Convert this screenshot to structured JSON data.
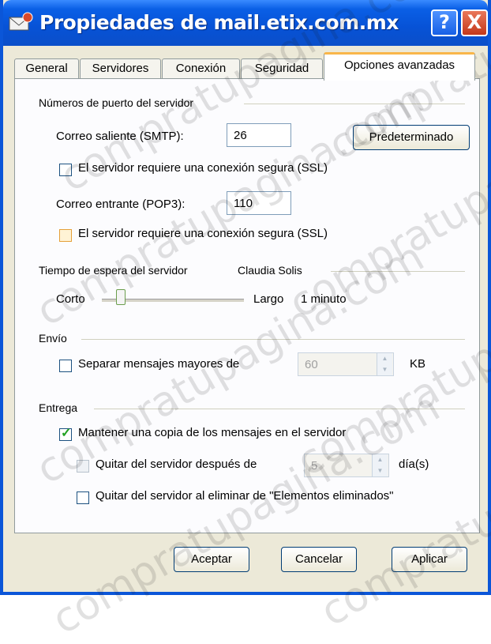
{
  "window": {
    "title": "Propiedades de mail.etix.com.mx",
    "help_label": "?",
    "close_label": "X"
  },
  "tabs": [
    {
      "label": "General"
    },
    {
      "label": "Servidores"
    },
    {
      "label": "Conexión"
    },
    {
      "label": "Seguridad"
    },
    {
      "label": "Opciones avanzadas",
      "active": true
    }
  ],
  "ports": {
    "group_title": "Números de puerto del servidor",
    "smtp_label": "Correo saliente (SMTP):",
    "smtp_value": "26",
    "default_button": "Predeterminado",
    "smtp_ssl_label": "El servidor requiere una conexión segura (SSL)",
    "pop3_label": "Correo entrante (POP3):",
    "pop3_value": "110",
    "pop3_ssl_label": "El servidor requiere una conexión segura (SSL)"
  },
  "timeout": {
    "group_title": "Tiempo de espera del servidor",
    "author": "Claudia Solis",
    "short_label": "Corto",
    "long_label": "Largo",
    "value": "1 minuto"
  },
  "send": {
    "group_title": "Envío",
    "split_label": "Separar mensajes mayores de",
    "split_value": "60",
    "unit": "KB"
  },
  "delivery": {
    "group_title": "Entrega",
    "keep_copy_label": "Mantener una copia de los mensajes en el servidor",
    "remove_after_label": "Quitar del servidor después de",
    "remove_after_value": "5",
    "days_label": "día(s)",
    "remove_deleted_label": "Quitar del servidor al eliminar de \"Elementos eliminados\""
  },
  "buttons": {
    "ok": "Aceptar",
    "cancel": "Cancelar",
    "apply": "Aplicar"
  },
  "watermark": "compratupagina.com",
  "colors": {
    "titlebar": "#0752d6",
    "active_tab_accent": "#f9b64a",
    "check": "#21a121"
  }
}
